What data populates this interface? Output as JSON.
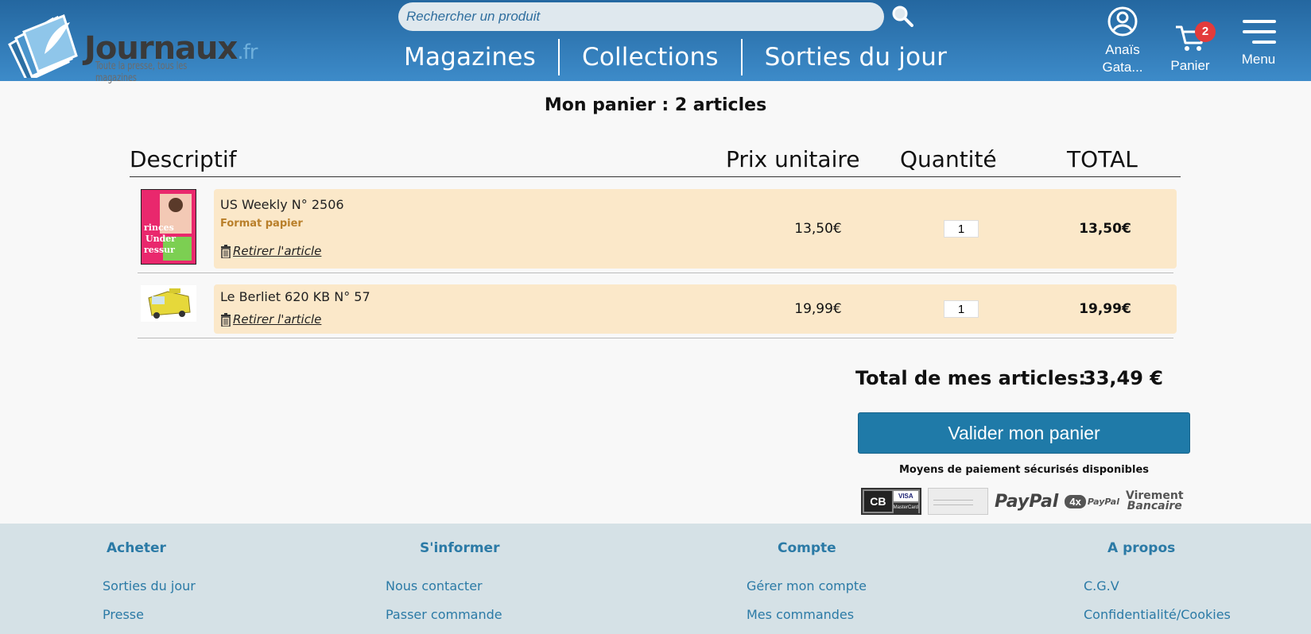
{
  "header": {
    "logo": {
      "name": "Journaux",
      "suffix": ".fr",
      "tagline": "Toute la presse, tous les magazines"
    },
    "search": {
      "placeholder": "Rechercher un produit",
      "value": ""
    },
    "nav": [
      "Magazines",
      "Collections",
      "Sorties du jour"
    ],
    "user": {
      "line1": "Anaïs",
      "line2": "Gata..."
    },
    "cart": {
      "label": "Panier",
      "count": "2"
    },
    "menu": {
      "label": "Menu"
    }
  },
  "cart": {
    "title": "Mon panier : 2 articles",
    "columns": {
      "desc": "Descriptif",
      "unit_price": "Prix unitaire",
      "quantity": "Quantité",
      "total": "TOTAL"
    },
    "items": [
      {
        "title": "US Weekly N° 2506",
        "format": "Format papier",
        "remove": "Retirer l'article",
        "unit_price": "13,50€",
        "quantity": "1",
        "total": "13,50€",
        "thumb": "magazine-cover"
      },
      {
        "title": "Le Berliet 620 KB N° 57",
        "format": "",
        "remove": "Retirer l'article",
        "unit_price": "19,99€",
        "quantity": "1",
        "total": "19,99€",
        "thumb": "yellow-truck-model"
      }
    ],
    "summary": {
      "label": "Total de mes articles:",
      "value": "33,49 €"
    },
    "validate_label": "Valider mon panier",
    "payment": {
      "title": "Moyens de paiement sécurisés disponibles",
      "cb_label": "CB",
      "visa_label": "VISA",
      "mastercard_label": "MasterCard",
      "paypal": "PayPal",
      "paypal4x_badge": "4x",
      "paypal4x_label": "PayPal",
      "virement": [
        "Virement",
        "Bancaire"
      ]
    }
  },
  "footer": {
    "columns": [
      {
        "title": "Acheter",
        "links": [
          "Sorties du jour",
          "Presse"
        ]
      },
      {
        "title": "S'informer",
        "links": [
          "Nous contacter",
          "Passer commande"
        ]
      },
      {
        "title": "Compte",
        "links": [
          "Gérer mon compte",
          "Mes commandes"
        ]
      },
      {
        "title": "A propos",
        "links": [
          "C.G.V",
          "Confidentialité/Cookies"
        ]
      }
    ]
  },
  "colors": {
    "header": "#2f7bb8",
    "accent": "#1f7aa8",
    "row": "#fbe8c9",
    "footer": "#d5e1e6",
    "badge": "#e33b3b"
  }
}
